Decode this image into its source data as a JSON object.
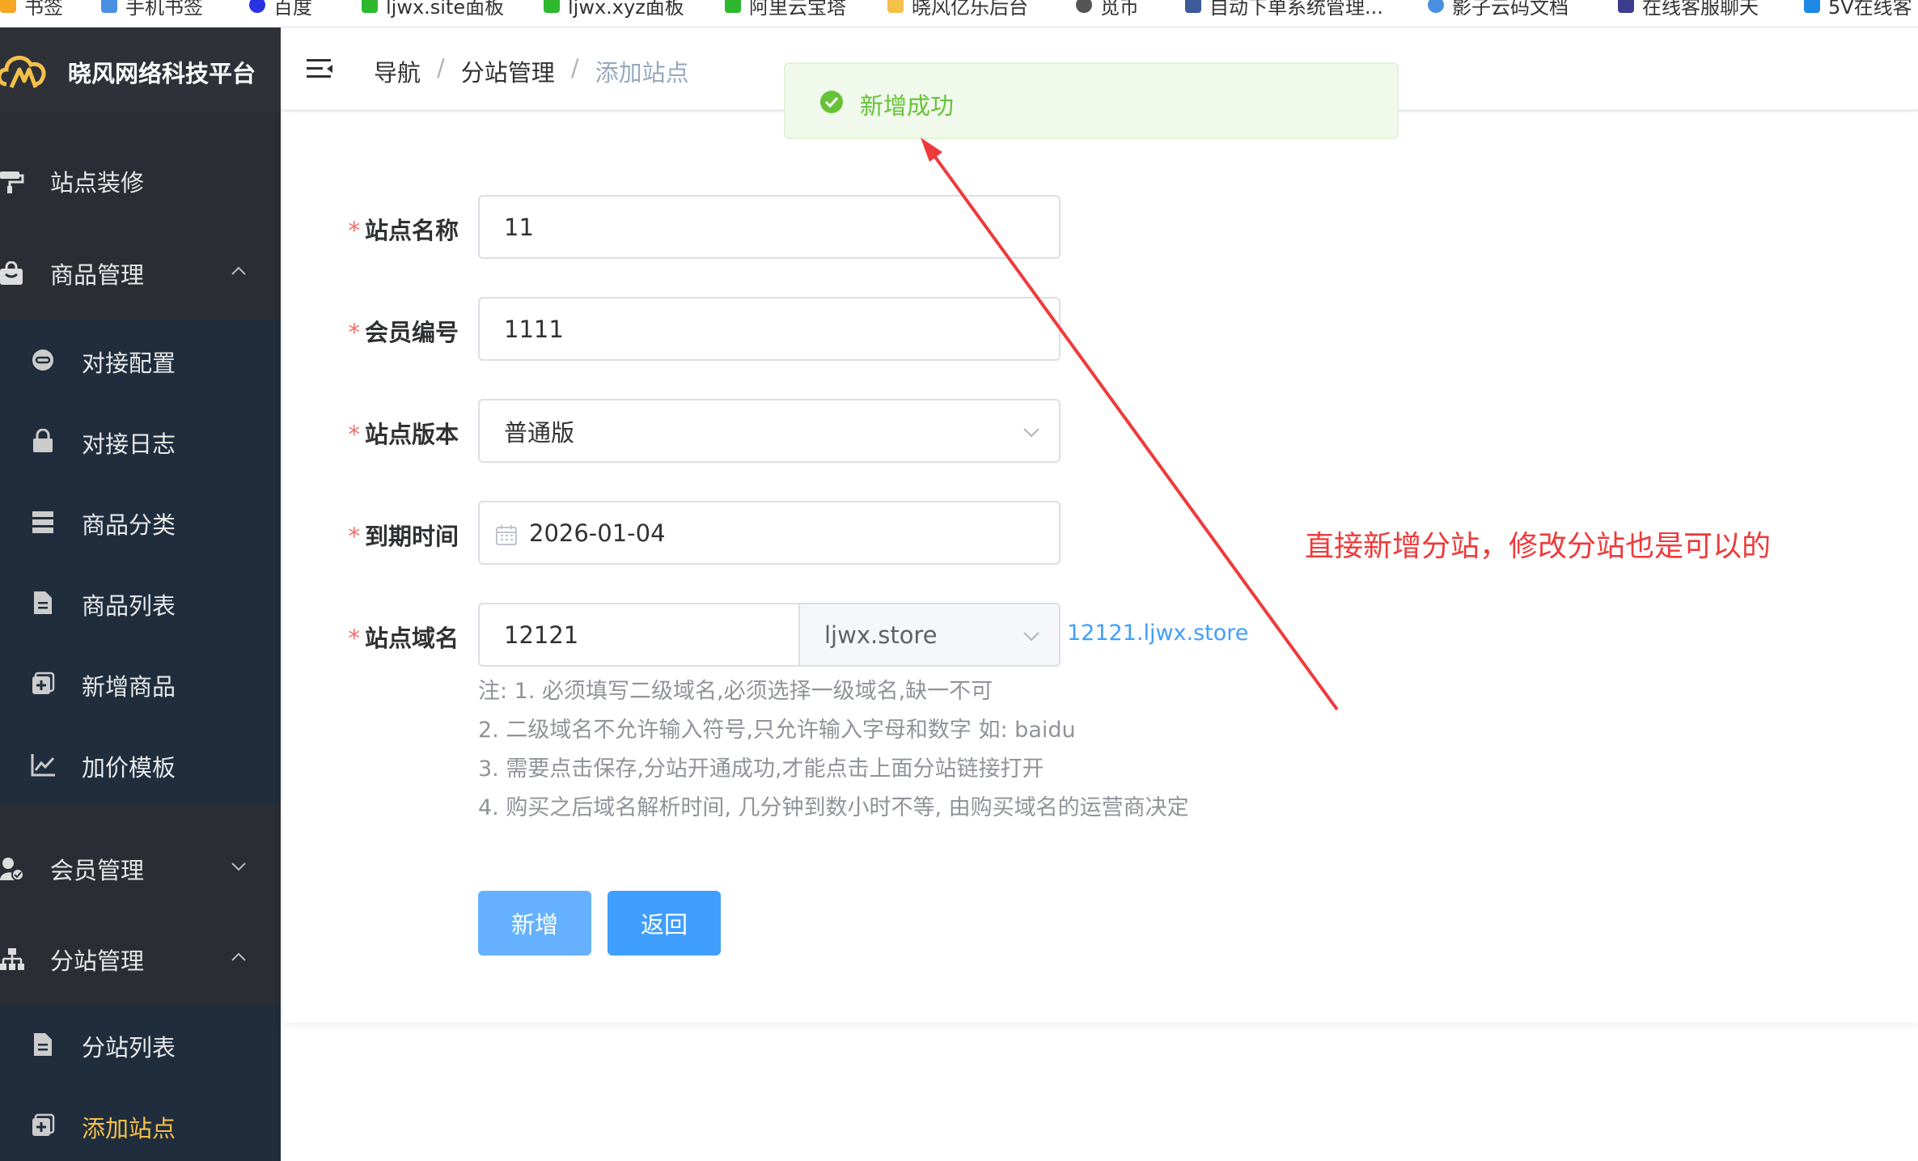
{
  "bookmarks": [
    {
      "label": "书签",
      "color": "#f5a623"
    },
    {
      "label": "手机书签",
      "color": "#4a90e2"
    },
    {
      "label": "百度",
      "color": "#2932e1"
    },
    {
      "label": "ljwx.site面板",
      "color": "#2eb82e"
    },
    {
      "label": "ljwx.xyz面板",
      "color": "#2eb82e"
    },
    {
      "label": "阿里云宝塔",
      "color": "#2eb82e"
    },
    {
      "label": "晓风亿乐后台",
      "color": "#f5c04a"
    },
    {
      "label": "觅币",
      "color": "#555555"
    },
    {
      "label": "自动下单系统管理...",
      "color": "#3d5a99"
    },
    {
      "label": "影子云码文档",
      "color": "#4a90e2"
    },
    {
      "label": "在线客服聊天",
      "color": "#3d3d8f"
    },
    {
      "label": "5V在线客",
      "color": "#1e88e5"
    }
  ],
  "brand": {
    "name": "晓风网络科技平台",
    "accent": "#f5c04a"
  },
  "sidebar": {
    "items": [
      {
        "label": "站点装修",
        "icon": "paint-roller-icon"
      },
      {
        "label": "商品管理",
        "icon": "shopping-bag-icon",
        "expanded": true
      },
      {
        "label": "会员管理",
        "icon": "user-check-icon",
        "expanded": false
      },
      {
        "label": "分站管理",
        "icon": "sitemap-icon",
        "expanded": true
      }
    ],
    "goods_sub": [
      {
        "label": "对接配置",
        "icon": "link-icon"
      },
      {
        "label": "对接日志",
        "icon": "lock-icon"
      },
      {
        "label": "商品分类",
        "icon": "server-icon"
      },
      {
        "label": "商品列表",
        "icon": "document-icon"
      },
      {
        "label": "新增商品",
        "icon": "add-square-icon"
      },
      {
        "label": "加价模板",
        "icon": "chart-line-icon"
      }
    ],
    "site_sub": [
      {
        "label": "分站列表",
        "icon": "document-icon"
      },
      {
        "label": "添加站点",
        "icon": "add-square-icon",
        "active": true
      }
    ]
  },
  "header": {
    "breadcrumb": [
      "导航",
      "分站管理",
      "添加站点"
    ],
    "separator": "/"
  },
  "toast": {
    "message": "新增成功",
    "color": "#67c23a"
  },
  "form": {
    "site_name": {
      "label": "站点名称",
      "value": "11"
    },
    "member_no": {
      "label": "会员编号",
      "value": "1111"
    },
    "version": {
      "label": "站点版本",
      "value": "普通版"
    },
    "expire": {
      "label": "到期时间",
      "value": "2026-01-04"
    },
    "domain": {
      "label": "站点域名",
      "sub": "12121",
      "root": "ljwx.store",
      "full": "12121.ljwx.store"
    },
    "required_mark": "*",
    "notes": [
      "注: 1. 必须填写二级域名,必须选择一级域名,缺一不可",
      "2. 二级域名不允许输入符号,只允许输入字母和数字 如: baidu",
      "3. 需要点击保存,分站开通成功,才能点击上面分站链接打开",
      "4. 购买之后域名解析时间, 几分钟到数小时不等, 由购买域名的运营商决定"
    ],
    "buttons": {
      "add": "新增",
      "back": "返回"
    }
  },
  "annotation": {
    "text": "直接新增分站，修改分站也是可以的",
    "color": "#ee3a3a"
  }
}
